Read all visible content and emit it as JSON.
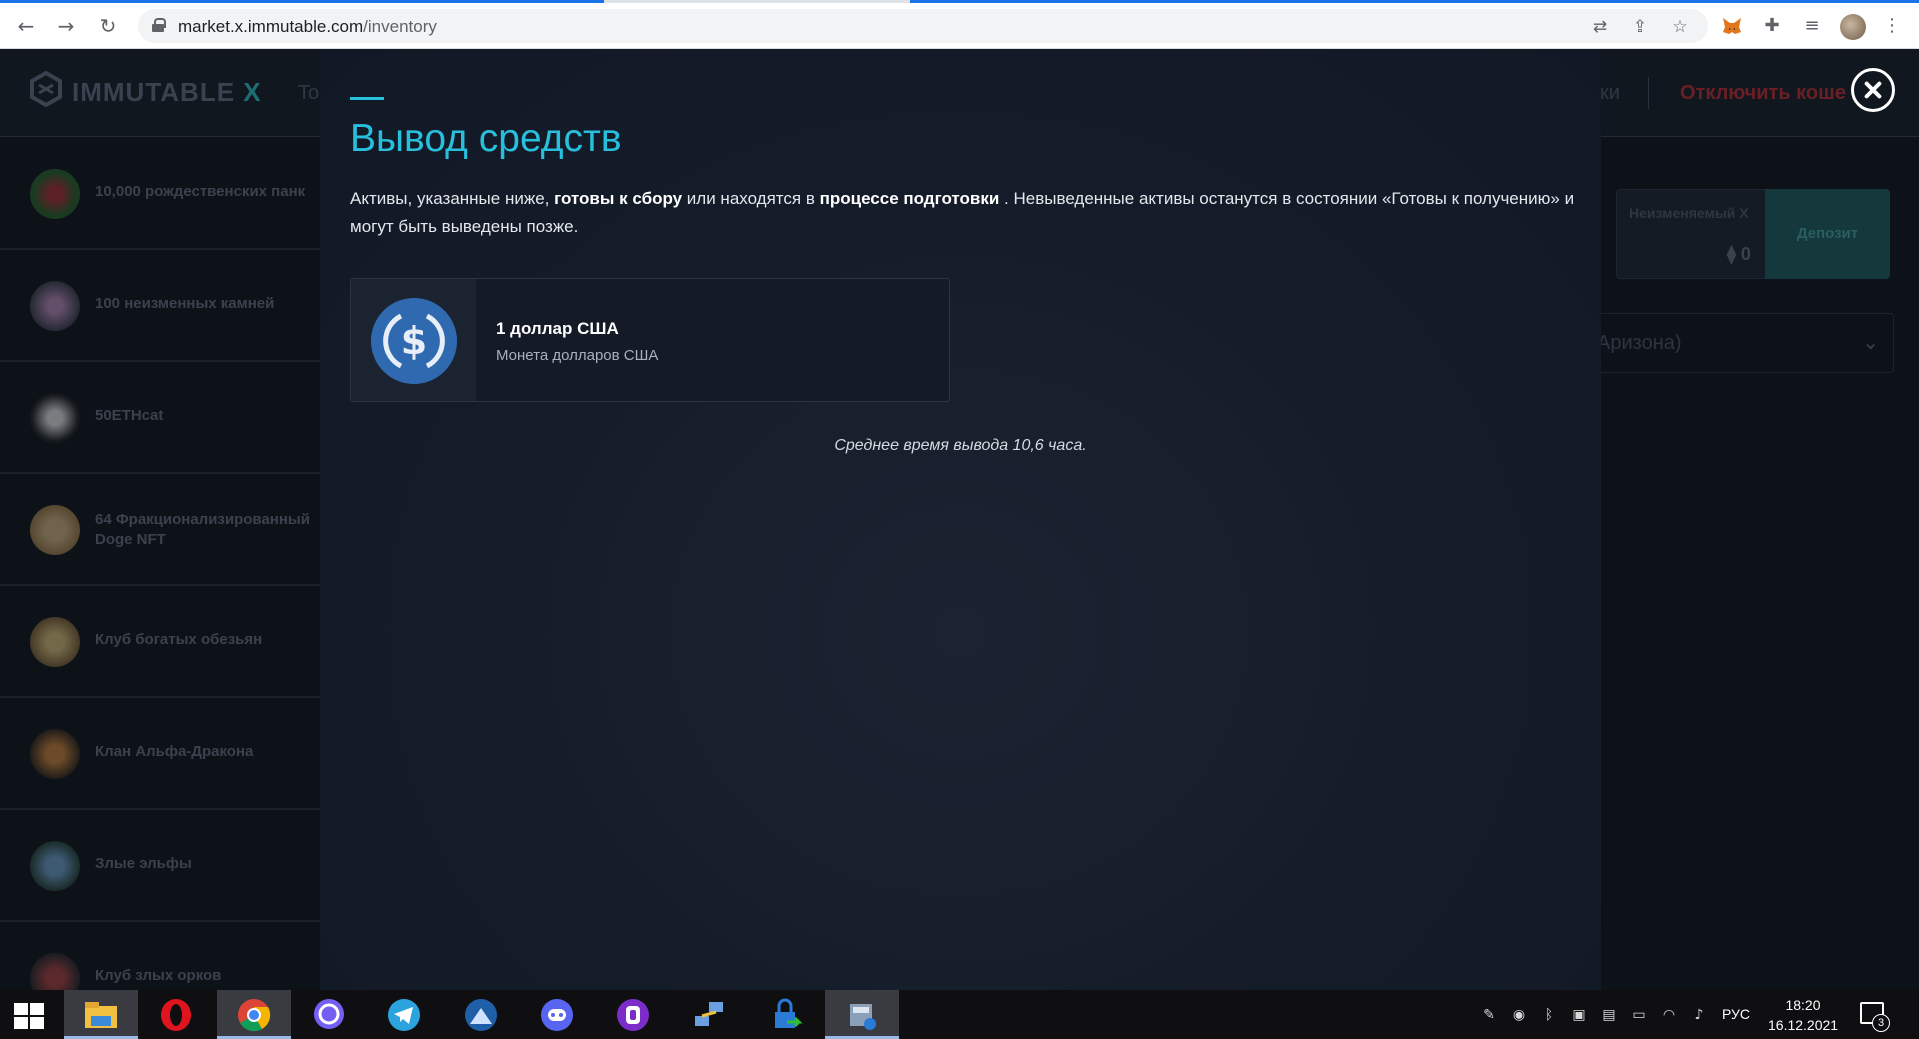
{
  "browser": {
    "url_host": "market.x.immutable.com",
    "url_path": "/inventory",
    "back_icon": "arrow-left",
    "forward_icon": "arrow-right",
    "reload_icon": "reload",
    "menu_icon": "⋮"
  },
  "app": {
    "logo_text": "IMMUTABLE",
    "logo_x": "X",
    "header_fragment_left": "To",
    "header_fragment_right": "ки",
    "header_disconnect": "Отключить коше",
    "sidebar": [
      {
        "label": "10,000 рождественских панк"
      },
      {
        "label": "100 неизменных камней"
      },
      {
        "label": "50ETHcat"
      },
      {
        "label": "64 Фракционализированный Doge NFT"
      },
      {
        "label": "Клуб богатых обезьян"
      },
      {
        "label": "Клан Альфа-Дракона"
      },
      {
        "label": "Злые эльфы"
      },
      {
        "label": "Клуб злых орков"
      }
    ],
    "balance": {
      "title": "Неизменяемый X",
      "value": "⧫ 0"
    },
    "deposit_label": "Депозит",
    "region": "Аризона)"
  },
  "modal": {
    "title": "Вывод средств",
    "desc_1": "Активы, указанные ниже, ",
    "desc_bold_1": "готовы к сбору",
    "desc_2": " или находятся в ",
    "desc_bold_2": "процессе подготовки",
    "desc_3": " . Невыведенные активы останутся в состоянии «Готовы к получению» и могут быть выведены позже.",
    "asset": {
      "name": "1 доллар США",
      "subtitle": "Монета долларов США",
      "icon": "usdc-coin-icon"
    },
    "avg_time": "Среднее время вывода 10,6 часа."
  },
  "taskbar": {
    "lang": "РУС",
    "time": "18:20",
    "date": "16.12.2021",
    "notifications": "3"
  }
}
